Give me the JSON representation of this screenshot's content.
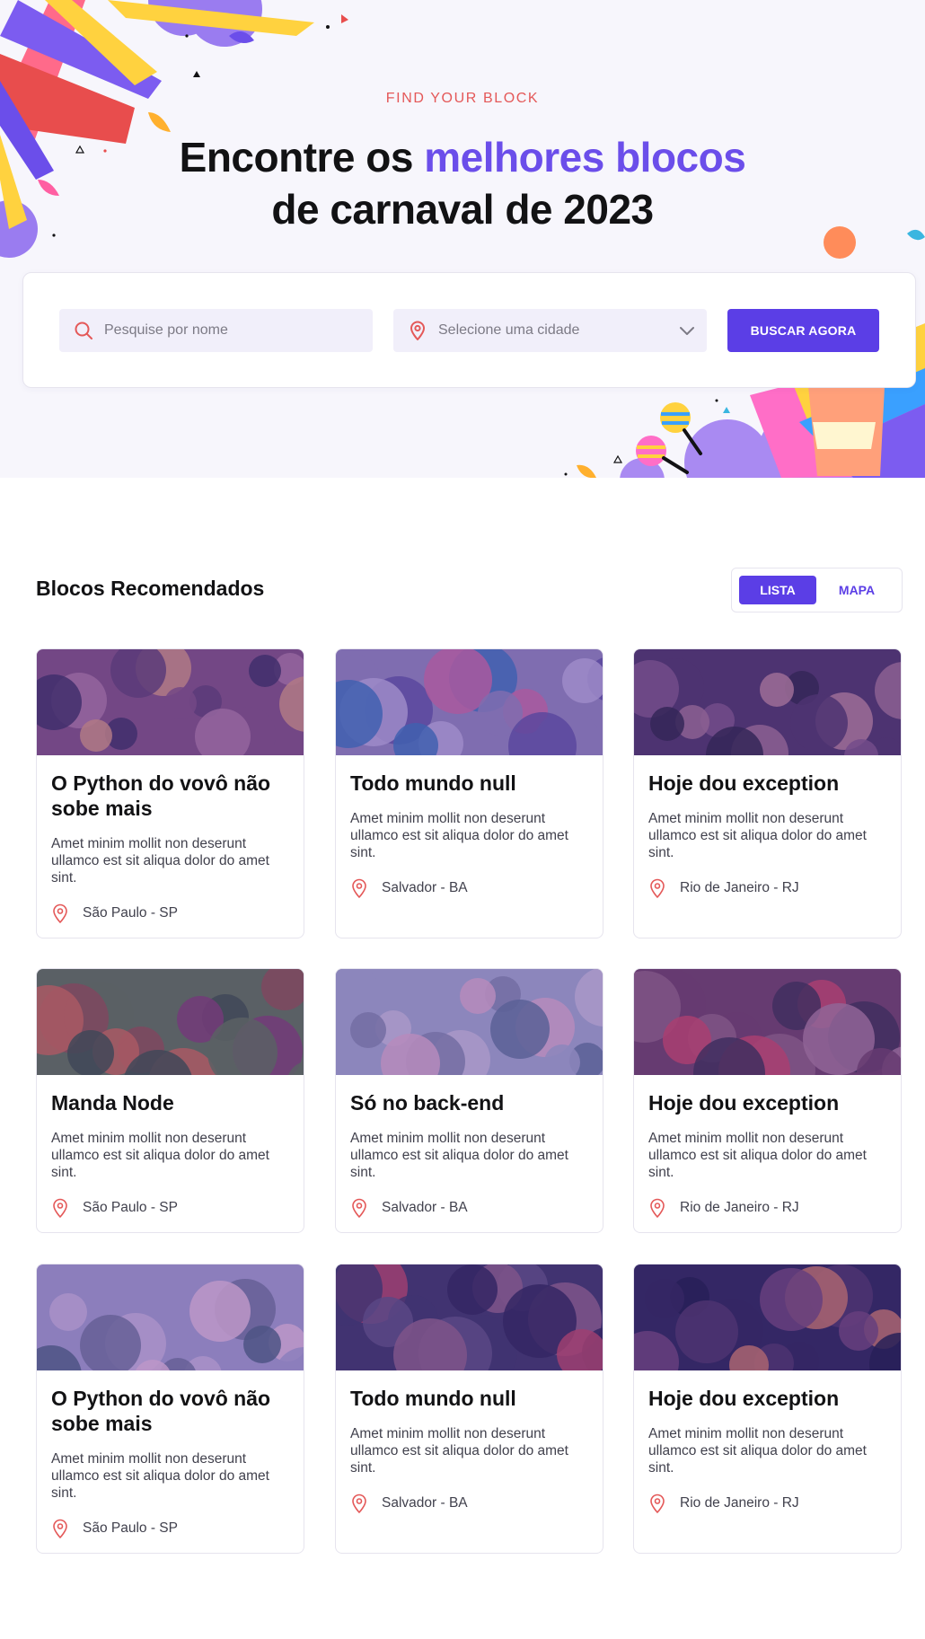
{
  "hero": {
    "eyebrow": "FIND YOUR BLOCK",
    "headline_part1": "Encontre os ",
    "headline_highlight": "melhores blocos",
    "headline_part2": "de carnaval de 2023"
  },
  "search": {
    "name_placeholder": "Pesquise por nome",
    "city_placeholder": "Selecione uma cidade",
    "button_label": "BUSCAR AGORA"
  },
  "section": {
    "title": "Blocos Recomendados",
    "view_list": "LISTA",
    "view_map": "MAPA",
    "active_view": "LISTA"
  },
  "cards": [
    {
      "title": "O Python do vovô não sobe mais",
      "description": "Amet minim mollit non deserunt ullamco est sit aliqua dolor do amet sint.",
      "location": "São Paulo - SP"
    },
    {
      "title": "Todo mundo null",
      "description": "Amet minim mollit non deserunt ullamco est sit aliqua dolor do amet sint.",
      "location": "Salvador - BA"
    },
    {
      "title": "Hoje dou exception",
      "description": "Amet minim mollit non deserunt ullamco est sit aliqua dolor do amet sint.",
      "location": "Rio de Janeiro - RJ"
    },
    {
      "title": "Manda Node",
      "description": "Amet minim mollit non deserunt ullamco est sit aliqua dolor do amet sint.",
      "location": "São Paulo - SP"
    },
    {
      "title": "Só no back-end",
      "description": "Amet minim mollit non deserunt ullamco est sit aliqua dolor do amet sint.",
      "location": "Salvador - BA"
    },
    {
      "title": "Hoje dou exception",
      "description": "Amet minim mollit non deserunt ullamco est sit aliqua dolor do amet sint.",
      "location": "Rio de Janeiro - RJ"
    },
    {
      "title": "O Python do vovô não sobe mais",
      "description": "Amet minim mollit non deserunt ullamco est sit aliqua dolor do amet sint.",
      "location": "São Paulo - SP"
    },
    {
      "title": "Todo mundo null",
      "description": "Amet minim mollit non deserunt ullamco est sit aliqua dolor do amet sint.",
      "location": "Salvador - BA"
    },
    {
      "title": "Hoje dou exception",
      "description": "Amet minim mollit non deserunt ullamco est sit aliqua dolor do amet sint.",
      "location": "Rio de Janeiro - RJ"
    }
  ],
  "colors": {
    "accent": "#5b3ee6",
    "highlight": "#6b4eea",
    "eyebrow": "#e45858",
    "pin": "#e45858"
  },
  "icons": {
    "search": "search-icon",
    "city": "map-pin-icon",
    "dropdown": "chevron-down-icon",
    "location": "map-pin-icon"
  }
}
